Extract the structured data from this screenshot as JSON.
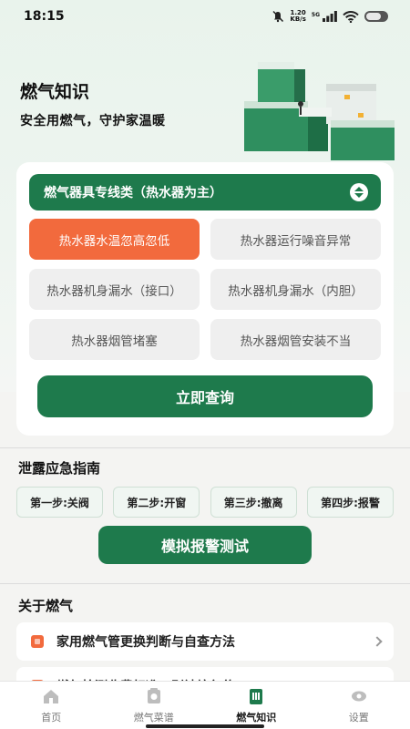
{
  "status_bar": {
    "time": "18:15",
    "net_speed_value": "1.20",
    "net_speed_unit": "KB/s",
    "signal_label": "5G"
  },
  "hero": {
    "title": "燃气知识",
    "subtitle": "安全用燃气，守护家温暖",
    "illustration_icon": "books-stack-illustration"
  },
  "category_select": {
    "selected": "燃气器具专线类（热水器为主）"
  },
  "issues": [
    {
      "label": "热水器水温忽高忽低",
      "active": true
    },
    {
      "label": "热水器运行噪音异常",
      "active": false
    },
    {
      "label": "热水器机身漏水（接口）",
      "active": false
    },
    {
      "label": "热水器机身漏水（内胆）",
      "active": false
    },
    {
      "label": "热水器烟管堵塞",
      "active": false
    },
    {
      "label": "热水器烟管安装不当",
      "active": false
    }
  ],
  "query_button": "立即查询",
  "leak_guide": {
    "title": "泄露应急指南",
    "steps": [
      "第一步:关阀",
      "第二步:开窗",
      "第三步:撤离",
      "第四步:报警"
    ],
    "alarm_button": "模拟报警测试"
  },
  "about": {
    "title": "关于燃气",
    "articles": [
      "家用燃气管更换判断与自查方法",
      "燃气检测收费标准：别被坑忽悠"
    ]
  },
  "tabs": [
    {
      "label": "首页",
      "icon": "home-icon",
      "active": false
    },
    {
      "label": "燃气菜谱",
      "icon": "recipe-icon",
      "active": false
    },
    {
      "label": "燃气知识",
      "icon": "knowledge-icon",
      "active": true
    },
    {
      "label": "设置",
      "icon": "settings-icon",
      "active": false
    }
  ],
  "colors": {
    "primary": "#1e7a4c",
    "accent": "#f26a3d"
  }
}
